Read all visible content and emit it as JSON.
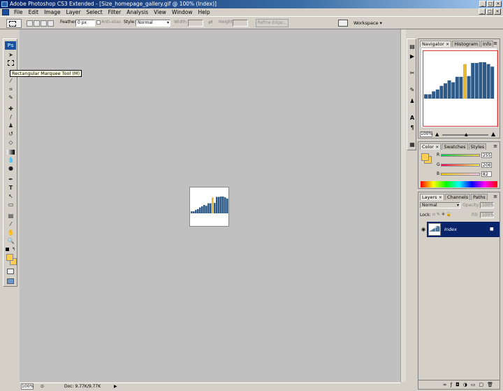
{
  "window": {
    "title": "Adobe Photoshop CS3 Extended - [Size_homepage_gallery.gif @ 100% (Index)]"
  },
  "menu": [
    "File",
    "Edit",
    "Image",
    "Layer",
    "Select",
    "Filter",
    "Analysis",
    "View",
    "Window",
    "Help"
  ],
  "options": {
    "feather_label": "Feather:",
    "feather_value": "0 px",
    "antialias_label": "Anti-alias",
    "style_label": "Style:",
    "style_value": "Normal",
    "width_label": "Width:",
    "height_label": "Height:",
    "refine_label": "Refine Edge...",
    "workspace_label": "Workspace ▾"
  },
  "toolbox": {
    "logo": "Ps"
  },
  "tooltip": "Rectangular Marquee Tool (M)",
  "status": {
    "zoom": "100%",
    "doc": "Doc: 9.77K/9.77K"
  },
  "navigator": {
    "tabs": [
      "Navigator ×",
      "Histogram",
      "Info"
    ],
    "zoom": "100%",
    "bar_values": [
      0.12,
      0.12,
      0.2,
      0.25,
      0.35,
      0.42,
      0.5,
      0.45,
      0.6,
      0.6,
      0.95,
      0.62,
      0.98,
      0.98,
      1.0,
      1.0,
      0.95,
      0.88
    ],
    "bar_color": "#2e5a88",
    "highlight_index": 10,
    "highlight_color": "#e8b830"
  },
  "color": {
    "tabs": [
      "Color ×",
      "Swatches",
      "Styles"
    ],
    "R": {
      "label": "R",
      "value": "255"
    },
    "G": {
      "label": "G",
      "value": "206"
    },
    "B": {
      "label": "B",
      "value": "82"
    },
    "fg": "#ffce52"
  },
  "layers": {
    "tabs": [
      "Layers ×",
      "Channels",
      "Paths"
    ],
    "blend_mode": "Normal",
    "opacity_label": "Opacity:",
    "opacity_value": "100%",
    "lock_label": "Lock:",
    "fill_label": "Fill:",
    "fill_value": "100%",
    "layer_name": "Index"
  }
}
